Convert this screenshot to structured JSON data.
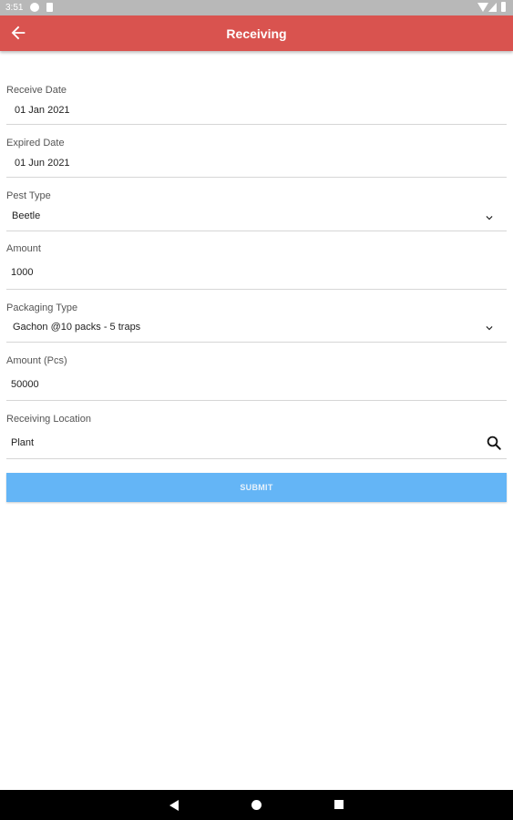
{
  "status_bar": {
    "time": "3:51"
  },
  "app_bar": {
    "title": "Receiving"
  },
  "form": {
    "receive_date": {
      "label": "Receive Date",
      "value": "01 Jan 2021"
    },
    "expired_date": {
      "label": "Expired Date",
      "value": "01 Jun 2021"
    },
    "pest_type": {
      "label": "Pest Type",
      "value": "Beetle"
    },
    "amount": {
      "label": "Amount",
      "value": "1000"
    },
    "packaging_type": {
      "label": "Packaging Type",
      "value": "Gachon @10 packs - 5 traps"
    },
    "amount_pcs": {
      "label": "Amount (Pcs)",
      "value": "50000"
    },
    "receiving_location": {
      "label": "Receiving Location",
      "value": "Plant"
    },
    "submit_label": "SUBMIT"
  },
  "colors": {
    "app_bar": "#d9534f",
    "submit": "#64b5f6"
  }
}
